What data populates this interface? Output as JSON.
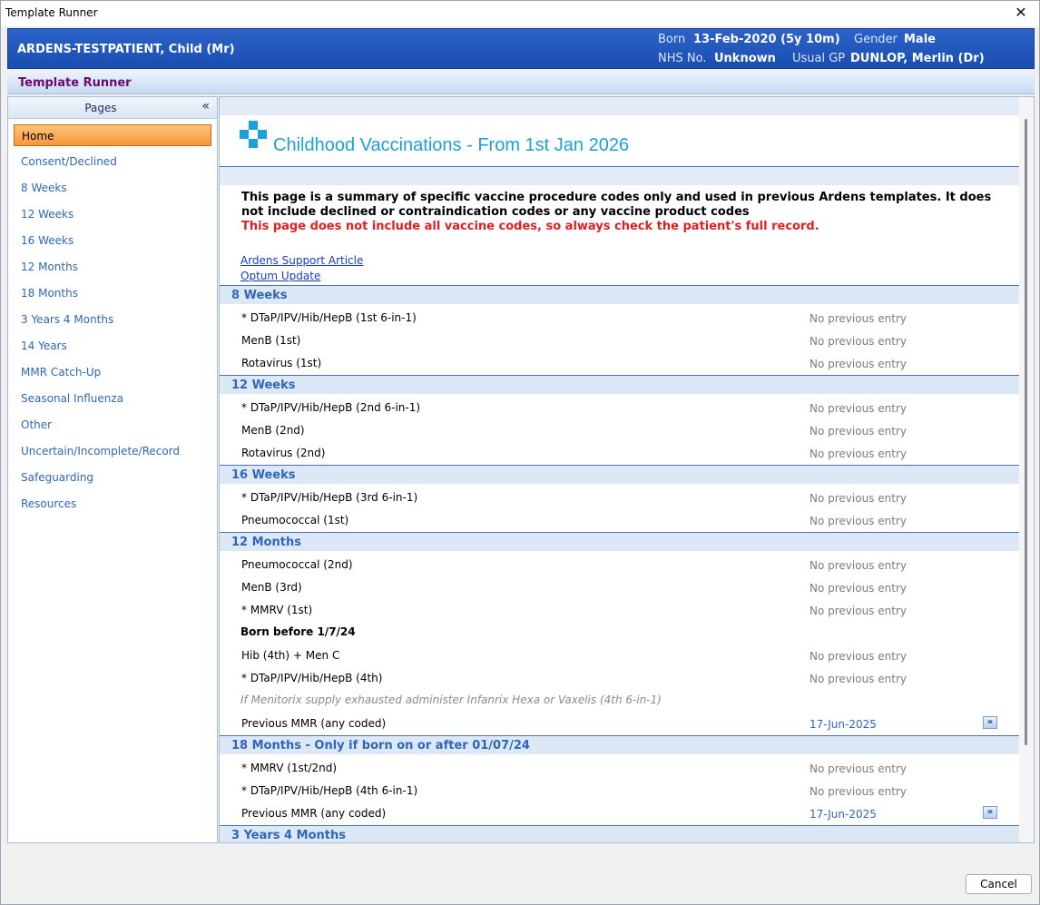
{
  "window": {
    "title": "Template Runner",
    "close_glyph": "✕"
  },
  "patient": {
    "name": "ARDENS-TESTPATIENT,  Child (Mr)",
    "born_label": "Born",
    "born_value": "13-Feb-2020 (5y 10m)",
    "gender_label": "Gender",
    "gender_value": "Male",
    "nhs_label": "NHS No.",
    "nhs_value": "Unknown",
    "gp_label": "Usual GP",
    "gp_value": "DUNLOP, Merlin (Dr)"
  },
  "header": {
    "title": "Template Runner"
  },
  "sidebar": {
    "title": "Pages",
    "collapse_glyph": "«",
    "items": [
      {
        "label": "Home"
      },
      {
        "label": "Consent/Declined"
      },
      {
        "label": "8 Weeks"
      },
      {
        "label": "12 Weeks"
      },
      {
        "label": "16 Weeks"
      },
      {
        "label": "12 Months"
      },
      {
        "label": "18 Months"
      },
      {
        "label": "3 Years 4 Months"
      },
      {
        "label": "14 Years"
      },
      {
        "label": "MMR Catch-Up"
      },
      {
        "label": "Seasonal Influenza"
      },
      {
        "label": "Other"
      },
      {
        "label": "Uncertain/Incomplete/Record"
      },
      {
        "label": "Safeguarding"
      },
      {
        "label": "Resources"
      }
    ]
  },
  "main": {
    "title": "Childhood Vaccinations - From 1st Jan 2026",
    "intro": "This page is a summary of specific vaccine procedure codes only and used in previous Ardens templates. It does not include declined or contraindication codes or any vaccine product codes",
    "warning": "This page does not include all vaccine codes, so always check the patient's full record.",
    "links": [
      "Ardens Support Article",
      "Optum Update"
    ],
    "status_none": "No previous entry",
    "go_glyph": "»",
    "sections": [
      {
        "title": "8 Weeks",
        "rows": [
          {
            "label": "* DTaP/IPV/Hib/HepB (1st 6-in-1)",
            "status": "No previous entry"
          },
          {
            "label": "MenB (1st)",
            "status": "No previous entry"
          },
          {
            "label": "Rotavirus (1st)",
            "status": "No previous entry"
          }
        ]
      },
      {
        "title": "12 Weeks",
        "rows": [
          {
            "label": "* DTaP/IPV/Hib/HepB (2nd 6-in-1)",
            "status": "No previous entry"
          },
          {
            "label": "MenB (2nd)",
            "status": "No previous entry"
          },
          {
            "label": "Rotavirus (2nd)",
            "status": "No previous entry"
          }
        ]
      },
      {
        "title": "16 Weeks",
        "rows": [
          {
            "label": "* DTaP/IPV/Hib/HepB (3rd 6-in-1)",
            "status": "No previous entry"
          },
          {
            "label": "Pneumococcal (1st)",
            "status": "No previous entry"
          }
        ]
      },
      {
        "title": "12 Months",
        "rows": [
          {
            "label": "Pneumococcal (2nd)",
            "status": "No previous entry"
          },
          {
            "label": "MenB (3rd)",
            "status": "No previous entry"
          },
          {
            "label": "* MMRV (1st)",
            "status": "No previous entry"
          }
        ],
        "subheading": "Born before 1/7/24",
        "sub_rows": [
          {
            "label": "Hib (4th) + Men C",
            "status": "No previous entry"
          },
          {
            "label": "* DTaP/IPV/Hib/HepB (4th)",
            "status": "No previous entry"
          }
        ],
        "note": "If Menitorix supply exhausted administer Infanrix Hexa or Vaxelis (4th 6-in-1)",
        "mmr_row": {
          "label": "Previous MMR (any coded)",
          "date": "17-Jun-2025"
        }
      },
      {
        "title": "18 Months - Only if born on or after 01/07/24",
        "rows": [
          {
            "label": "* MMRV (1st/2nd)",
            "status": "No previous entry"
          },
          {
            "label": "* DTaP/IPV/Hib/HepB (4th 6-in-1)",
            "status": "No previous entry"
          }
        ],
        "mmr_row": {
          "label": "Previous MMR (any coded)",
          "date": "17-Jun-2025"
        }
      },
      {
        "title": "3 Years 4 Months"
      }
    ]
  },
  "footer": {
    "cancel_label": "Cancel"
  },
  "colors": {
    "banner": "#1a4eb0",
    "accent_orange": "#f7963a",
    "section_text": "#2f66b8",
    "title_cyan": "#1ba1d8",
    "warning_red": "#e02020"
  }
}
